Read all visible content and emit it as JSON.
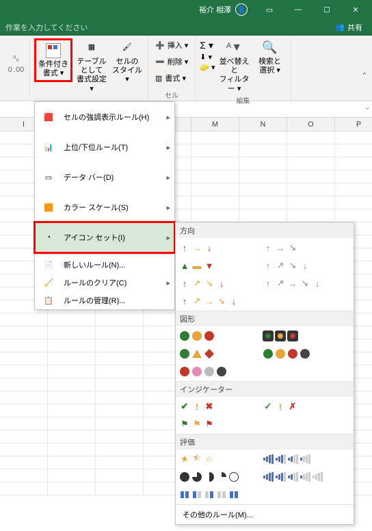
{
  "titlebar": {
    "username": "裕介 相澤"
  },
  "tellme": "作業を入力してください",
  "share": "共有",
  "ribbon": {
    "cond_format": "条件付き\n書式 ▾",
    "table_format": "テーブルとして\n書式設定 ▾",
    "cell_styles": "セルの\nスタイル ▾",
    "insert": "挿入 ▾",
    "delete": "削除 ▾",
    "format": "書式 ▾",
    "sort_filter": "並べ替えと\nフィルター ▾",
    "find_select": "検索と\n選択 ▾",
    "group_cells": "セル",
    "group_edit": "編集",
    "number_fmt1": "0",
    "number_fmt2": ".00"
  },
  "columns": [
    "I",
    "",
    "",
    "",
    "M",
    "N",
    "O",
    "P"
  ],
  "menu": {
    "highlight": "セルの強調表示ルール(H)",
    "topbottom": "上位/下位ルール(T)",
    "databars": "データ バー(D)",
    "colorscales": "カラー スケール(S)",
    "iconsets": "アイコン セット(I)",
    "newrule": "新しいルール(N)...",
    "clear": "ルールのクリア(C)",
    "manage": "ルールの管理(R)..."
  },
  "flyout": {
    "sect_direction": "方向",
    "sect_shapes": "図形",
    "sect_indicators": "インジケーター",
    "sect_ratings": "評価",
    "more_rules": "その他のルール(M)..."
  }
}
